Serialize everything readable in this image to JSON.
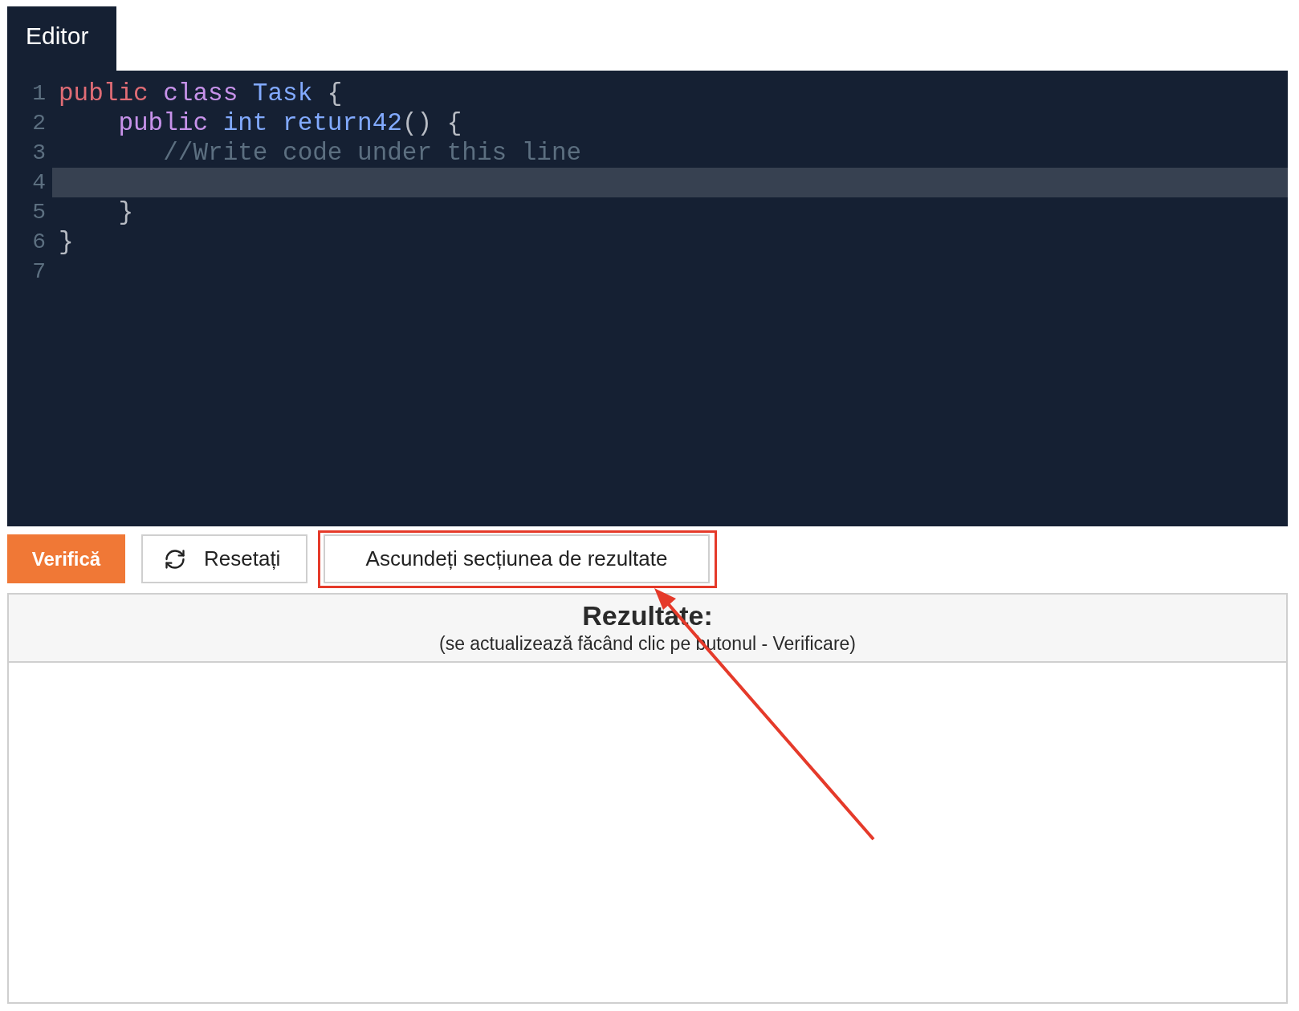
{
  "tabs": [
    {
      "label": "Editor",
      "selected": true
    }
  ],
  "editor": {
    "lines": [
      {
        "number": "1",
        "active": false,
        "tokens": [
          {
            "text": "public",
            "kind": "modifier"
          },
          {
            "text": " class",
            "kind": "keyword"
          },
          {
            "text": " Task",
            "kind": "name"
          },
          {
            "text": " {",
            "kind": "plain"
          }
        ]
      },
      {
        "number": "2",
        "active": false,
        "tokens": [
          {
            "text": "    public",
            "kind": "keyword"
          },
          {
            "text": " int",
            "kind": "name"
          },
          {
            "text": " return42",
            "kind": "name"
          },
          {
            "text": "() {",
            "kind": "plain"
          }
        ]
      },
      {
        "number": "3",
        "active": false,
        "tokens": [
          {
            "text": "       //Write code under this line",
            "kind": "comment"
          }
        ]
      },
      {
        "number": "4",
        "active": true
      },
      {
        "number": "5",
        "active": false,
        "tokens": [
          {
            "text": "    }",
            "kind": "plain"
          }
        ]
      },
      {
        "number": "6",
        "active": false,
        "tokens": [
          {
            "text": "}",
            "kind": "plain"
          }
        ]
      },
      {
        "number": "7",
        "active": false
      }
    ]
  },
  "buttons": [
    {
      "label": "Verifică",
      "kind": "primary"
    },
    {
      "label": "Resetați",
      "kind": "reset"
    },
    {
      "label": "Ascundeți secțiunea de rezultate",
      "kind": "outline"
    }
  ],
  "results": {
    "title": "Rezultate:",
    "subtitle": "(se actualizează făcând clic pe butonul - Verificare)"
  }
}
